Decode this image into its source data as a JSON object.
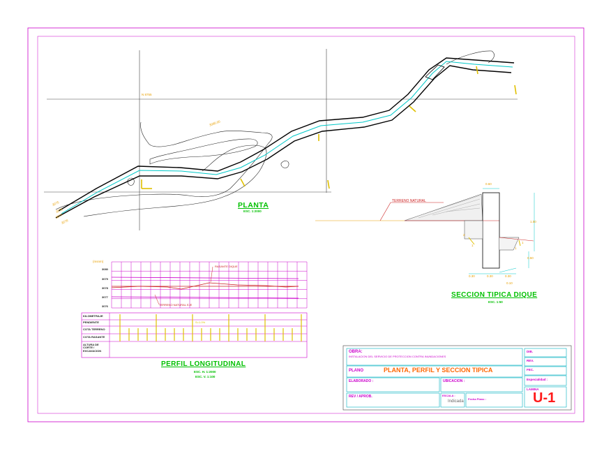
{
  "planta": {
    "title": "PLANTA",
    "scale": "ESC. 1:2000",
    "grid_labels": [
      "N 8755",
      "E 9855"
    ],
    "contour_label": "3080.00",
    "left_labels": [
      "3075",
      "3076",
      "3077",
      "3078"
    ]
  },
  "seccion": {
    "title": "SECCION TIPICA DIQUE",
    "scale": "ESC. 1:50",
    "terrain_label": "TERRENO NATURAL",
    "dims": [
      "0.60",
      "1.50",
      "0.50",
      "0.30",
      "0.30",
      "0.10",
      "0.30"
    ],
    "slopes": [
      "2",
      "1",
      "1",
      "1"
    ]
  },
  "perfil": {
    "title": "PERFIL LONGITUDINAL",
    "scale_h": "ESC. H. 1:2000",
    "scale_v": "ESC. V. 1:100",
    "y_unit": "(msnm)",
    "y_ticks": [
      "3080",
      "3079",
      "3078",
      "3077",
      "3076"
    ],
    "callout_top": "RASANTE DIQUE",
    "callout_bottom": "TERRENO NATURAL EJE",
    "rows": [
      "KILOMETRAJE",
      "PENDIENTE",
      "COTA TERRENO",
      "COTA RASANTE",
      "ALTURA DE CORTE / EXCAVACION"
    ],
    "pendiente": "S=1.0%"
  },
  "title_block": {
    "obra_label": "OBRA:",
    "obra_text": "INSTALACION DEL SERVICIO DE PROTECCION CONTRA INUNDACIONES",
    "plano_label": "PLANO",
    "plano_text": "PLANTA, PERFIL Y SECCION TIPICA",
    "elaborado": "ELABORADO :",
    "ubicacion": "UBICACION :",
    "revisado": "REV / APROB.",
    "escala": "ESCALA :",
    "escala_val": "Indicada",
    "fecha": "Fecha Plano :",
    "dib": "DIB.",
    "rev": "REV.",
    "fec": "FEC.",
    "especialidad": "Especialidad :",
    "lamina_label": "LAMINA",
    "lamina": "U-1"
  },
  "colors": {
    "frame": "#cc00cc",
    "river": "#00c8c8",
    "dike": "#000000",
    "accent": "#00c000",
    "marker": "#e0c000",
    "profile_grid": "#cc00cc",
    "profile_line": "#cc2020"
  }
}
